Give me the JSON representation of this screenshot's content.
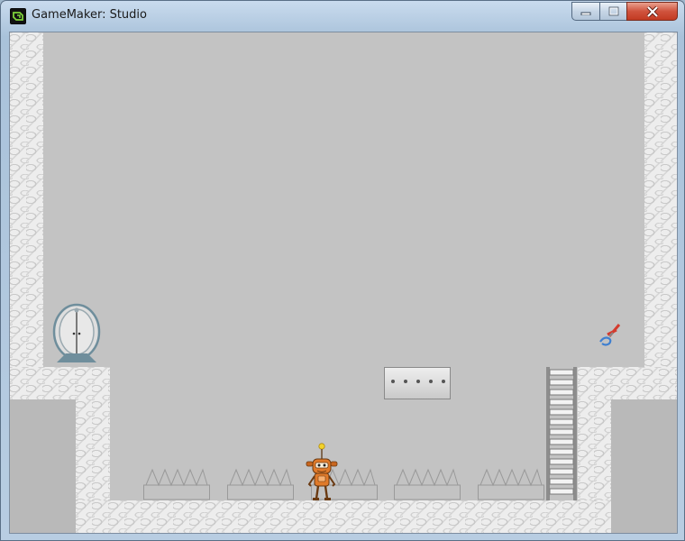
{
  "window": {
    "title": "GameMaker: Studio",
    "controls": [
      "minimize",
      "maximize",
      "close"
    ]
  },
  "icons": {
    "app": "gamemaker-logo-icon",
    "minimize": "minimize-icon",
    "maximize": "maximize-icon",
    "close": "close-icon"
  },
  "level": {
    "colors": {
      "background": "#c3c3c3",
      "stone": "#ededed",
      "player": "#e07a2a",
      "player_antenna": "#f2d22a",
      "door_frame": "#6f8e9c",
      "pickup_red": "#d43b2e",
      "pickup_blue": "#3e7fd0"
    },
    "objects": [
      "stone-walls",
      "exit-door",
      "robot-player",
      "floating-metal-platform",
      "metal-ladder",
      "spike-traps",
      "wire-cutter-pickup"
    ],
    "spike_trap_count": 5
  }
}
